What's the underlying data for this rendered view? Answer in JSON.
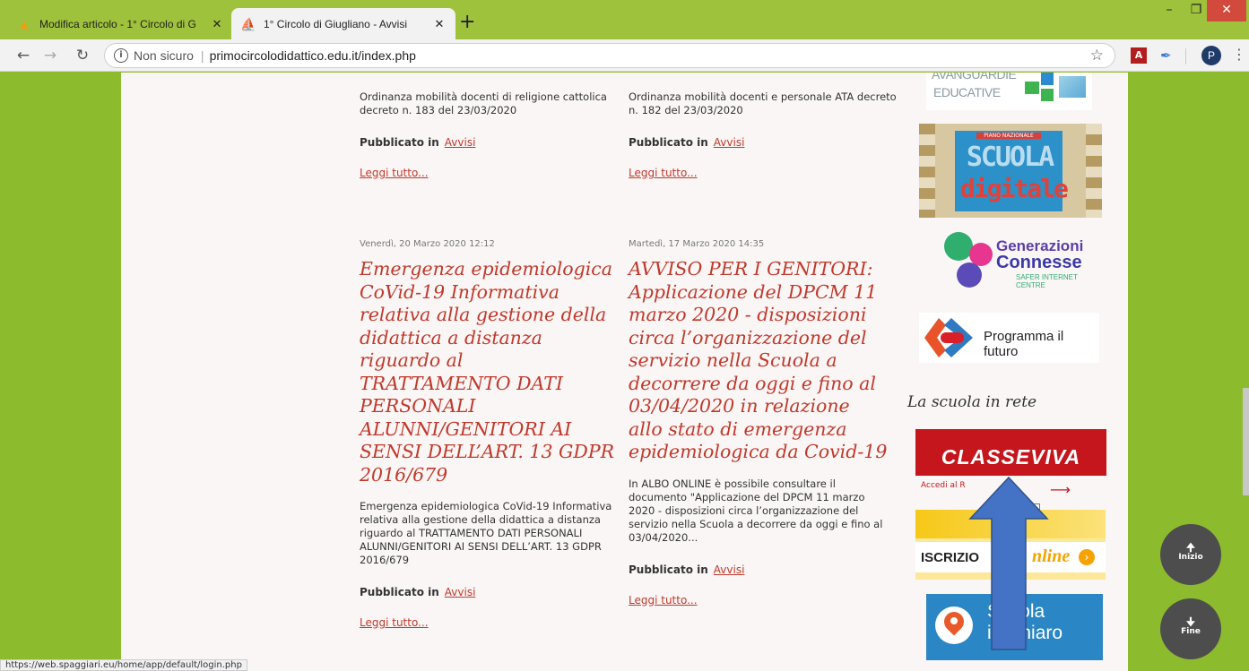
{
  "browser": {
    "tabs": [
      {
        "title": "Modifica articolo - 1° Circolo di G",
        "close": "✕"
      },
      {
        "title": "1° Circolo di Giugliano - Avvisi",
        "close": "✕"
      }
    ],
    "new_tab": "+",
    "window": {
      "minimize": "–",
      "maximize": "❐",
      "close": "✕"
    },
    "insecure_label": "Non sicuro",
    "url": "primocircolodidattico.edu.it/index.php",
    "profile_initial": "P"
  },
  "articles": [
    {
      "intro": "Ordinanza mobilità docenti di religione cattolica decreto n. 183 del 23/03/2020",
      "published_label": "Pubblicato in",
      "category": "Avvisi",
      "read_more": "Leggi tutto..."
    },
    {
      "intro": "Ordinanza mobilità docenti e personale ATA decreto n. 182 del 23/03/2020",
      "published_label": "Pubblicato in",
      "category": "Avvisi",
      "read_more": "Leggi tutto..."
    },
    {
      "date": "Venerdì, 20 Marzo 2020 12:12",
      "title": "Emergenza epidemiologica CoVid-19 Informativa relativa alla gestione della didattica a distanza riguardo al TRATTAMENTO DATI PERSONALI ALUNNI/GENITORI AI SENSI DELL’ART. 13 GDPR 2016/679",
      "intro": "Emergenza epidemiologica CoVid-19 Informativa relativa alla gestione della didattica a distanza riguardo al TRATTAMENTO DATI PERSONALI ALUNNI/GENITORI AI SENSI DELL’ART. 13 GDPR 2016/679",
      "published_label": "Pubblicato in",
      "category": "Avvisi",
      "read_more": "Leggi tutto..."
    },
    {
      "date": "Martedì, 17 Marzo 2020 14:35",
      "title": "AVVISO PER I GENITORI: Applicazione del DPCM 11 marzo 2020 - disposizioni circa l’organizzazione del servizio nella Scuola a decorrere da oggi e fino al 03/04/2020 in relazione allo stato di emergenza epidemiologica da Covid-19",
      "intro": "In ALBO ONLINE è possibile consultare il documento \"Applicazione del DPCM 11 marzo 2020 - disposizioni circa l’organizzazione del servizio nella Scuola a decorrere da oggi e fino al 03/04/2020...",
      "published_label": "Pubblicato in",
      "category": "Avvisi",
      "read_more": "Leggi tutto..."
    }
  ],
  "sidebar": {
    "avanguardie": {
      "line1": "AVANGUARDIE",
      "line2": "EDUCATIVE"
    },
    "scuola_digitale": {
      "top": "PIANO NAZIONALE",
      "word1": "SCUOLA",
      "word2": "digitale"
    },
    "generazioni": {
      "line1": "Generazioni",
      "line2": "Connesse",
      "line3": "SAFER INTERNET CENTRE"
    },
    "programma": "Programma il futuro",
    "section_title": "La scuola in rete",
    "classeviva": {
      "logo": "CLASSEVIVA",
      "sub": "Accedi al R"
    },
    "tooltip": "terno",
    "iscrizioni": {
      "text": "ISCRIZIO",
      "tail": "nline"
    },
    "scuola_chiaro": {
      "line1": "Scuola",
      "line2": "in Chiaro"
    }
  },
  "scroll_buttons": {
    "up": "Inizio",
    "down": "Fine"
  },
  "status_url": "https://web.spaggiari.eu/home/app/default/login.php",
  "colors": {
    "accent": "#c0392b",
    "frame": "#8dbb2e",
    "arrow": "#4472c4"
  }
}
